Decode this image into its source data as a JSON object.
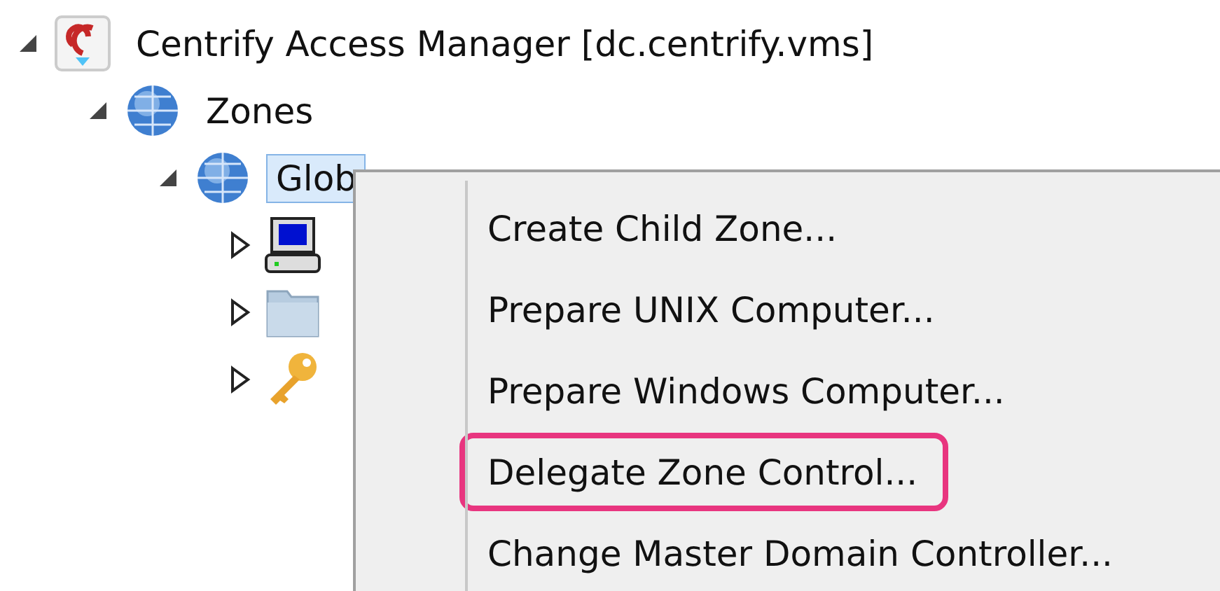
{
  "tree": [
    {
      "label": "Centrify Access Manager [dc.centrify.vms]",
      "kind": "app",
      "expanded": true,
      "selected": false,
      "children": [
        {
          "label": "Zones",
          "kind": "globe",
          "expanded": true,
          "selected": false,
          "children": [
            {
              "label": "Glob",
              "kind": "globe",
              "expanded": true,
              "selected": true,
              "children": [
                {
                  "kind": "computer",
                  "expanded": false
                },
                {
                  "kind": "folder",
                  "expanded": false
                },
                {
                  "kind": "key",
                  "expanded": false
                }
              ]
            }
          ]
        }
      ]
    }
  ],
  "context_menu": {
    "items": [
      {
        "label": "Create Child Zone...",
        "highlighted": false
      },
      {
        "label": "Prepare UNIX Computer...",
        "highlighted": false
      },
      {
        "label": "Prepare Windows Computer...",
        "highlighted": false
      },
      {
        "label": "Delegate Zone Control...",
        "highlighted": true
      },
      {
        "label": "Change Master Domain Controller...",
        "highlighted": false
      }
    ]
  }
}
